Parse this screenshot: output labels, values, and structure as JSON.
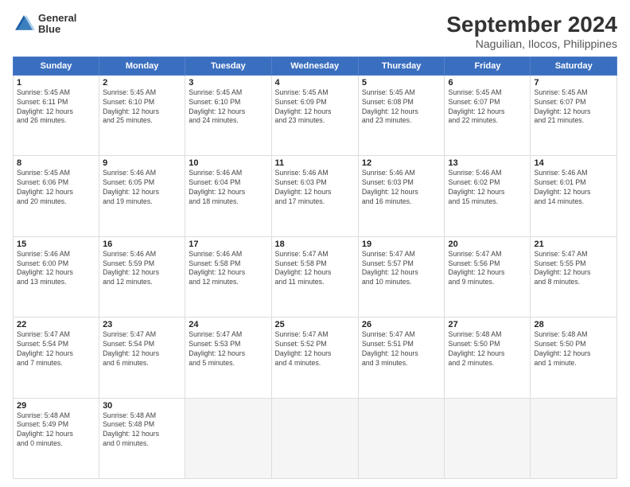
{
  "header": {
    "logo_line1": "General",
    "logo_line2": "Blue",
    "month": "September 2024",
    "location": "Naguilian, Ilocos, Philippines"
  },
  "weekdays": [
    "Sunday",
    "Monday",
    "Tuesday",
    "Wednesday",
    "Thursday",
    "Friday",
    "Saturday"
  ],
  "weeks": [
    [
      {
        "day": "1",
        "info": "Sunrise: 5:45 AM\nSunset: 6:11 PM\nDaylight: 12 hours\nand 26 minutes."
      },
      {
        "day": "2",
        "info": "Sunrise: 5:45 AM\nSunset: 6:10 PM\nDaylight: 12 hours\nand 25 minutes."
      },
      {
        "day": "3",
        "info": "Sunrise: 5:45 AM\nSunset: 6:10 PM\nDaylight: 12 hours\nand 24 minutes."
      },
      {
        "day": "4",
        "info": "Sunrise: 5:45 AM\nSunset: 6:09 PM\nDaylight: 12 hours\nand 23 minutes."
      },
      {
        "day": "5",
        "info": "Sunrise: 5:45 AM\nSunset: 6:08 PM\nDaylight: 12 hours\nand 23 minutes."
      },
      {
        "day": "6",
        "info": "Sunrise: 5:45 AM\nSunset: 6:07 PM\nDaylight: 12 hours\nand 22 minutes."
      },
      {
        "day": "7",
        "info": "Sunrise: 5:45 AM\nSunset: 6:07 PM\nDaylight: 12 hours\nand 21 minutes."
      }
    ],
    [
      {
        "day": "8",
        "info": "Sunrise: 5:45 AM\nSunset: 6:06 PM\nDaylight: 12 hours\nand 20 minutes."
      },
      {
        "day": "9",
        "info": "Sunrise: 5:46 AM\nSunset: 6:05 PM\nDaylight: 12 hours\nand 19 minutes."
      },
      {
        "day": "10",
        "info": "Sunrise: 5:46 AM\nSunset: 6:04 PM\nDaylight: 12 hours\nand 18 minutes."
      },
      {
        "day": "11",
        "info": "Sunrise: 5:46 AM\nSunset: 6:03 PM\nDaylight: 12 hours\nand 17 minutes."
      },
      {
        "day": "12",
        "info": "Sunrise: 5:46 AM\nSunset: 6:03 PM\nDaylight: 12 hours\nand 16 minutes."
      },
      {
        "day": "13",
        "info": "Sunrise: 5:46 AM\nSunset: 6:02 PM\nDaylight: 12 hours\nand 15 minutes."
      },
      {
        "day": "14",
        "info": "Sunrise: 5:46 AM\nSunset: 6:01 PM\nDaylight: 12 hours\nand 14 minutes."
      }
    ],
    [
      {
        "day": "15",
        "info": "Sunrise: 5:46 AM\nSunset: 6:00 PM\nDaylight: 12 hours\nand 13 minutes."
      },
      {
        "day": "16",
        "info": "Sunrise: 5:46 AM\nSunset: 5:59 PM\nDaylight: 12 hours\nand 12 minutes."
      },
      {
        "day": "17",
        "info": "Sunrise: 5:46 AM\nSunset: 5:58 PM\nDaylight: 12 hours\nand 12 minutes."
      },
      {
        "day": "18",
        "info": "Sunrise: 5:47 AM\nSunset: 5:58 PM\nDaylight: 12 hours\nand 11 minutes."
      },
      {
        "day": "19",
        "info": "Sunrise: 5:47 AM\nSunset: 5:57 PM\nDaylight: 12 hours\nand 10 minutes."
      },
      {
        "day": "20",
        "info": "Sunrise: 5:47 AM\nSunset: 5:56 PM\nDaylight: 12 hours\nand 9 minutes."
      },
      {
        "day": "21",
        "info": "Sunrise: 5:47 AM\nSunset: 5:55 PM\nDaylight: 12 hours\nand 8 minutes."
      }
    ],
    [
      {
        "day": "22",
        "info": "Sunrise: 5:47 AM\nSunset: 5:54 PM\nDaylight: 12 hours\nand 7 minutes."
      },
      {
        "day": "23",
        "info": "Sunrise: 5:47 AM\nSunset: 5:54 PM\nDaylight: 12 hours\nand 6 minutes."
      },
      {
        "day": "24",
        "info": "Sunrise: 5:47 AM\nSunset: 5:53 PM\nDaylight: 12 hours\nand 5 minutes."
      },
      {
        "day": "25",
        "info": "Sunrise: 5:47 AM\nSunset: 5:52 PM\nDaylight: 12 hours\nand 4 minutes."
      },
      {
        "day": "26",
        "info": "Sunrise: 5:47 AM\nSunset: 5:51 PM\nDaylight: 12 hours\nand 3 minutes."
      },
      {
        "day": "27",
        "info": "Sunrise: 5:48 AM\nSunset: 5:50 PM\nDaylight: 12 hours\nand 2 minutes."
      },
      {
        "day": "28",
        "info": "Sunrise: 5:48 AM\nSunset: 5:50 PM\nDaylight: 12 hours\nand 1 minute."
      }
    ],
    [
      {
        "day": "29",
        "info": "Sunrise: 5:48 AM\nSunset: 5:49 PM\nDaylight: 12 hours\nand 0 minutes."
      },
      {
        "day": "30",
        "info": "Sunrise: 5:48 AM\nSunset: 5:48 PM\nDaylight: 12 hours\nand 0 minutes."
      },
      {
        "day": "",
        "info": ""
      },
      {
        "day": "",
        "info": ""
      },
      {
        "day": "",
        "info": ""
      },
      {
        "day": "",
        "info": ""
      },
      {
        "day": "",
        "info": ""
      }
    ]
  ]
}
